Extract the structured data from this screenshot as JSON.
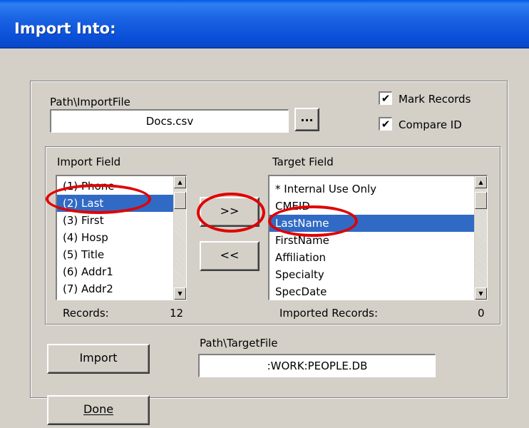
{
  "window": {
    "title": "Import Into:"
  },
  "import_file": {
    "label": "Path\\ImportFile",
    "value": "Docs.csv",
    "browse_label": "..."
  },
  "options": [
    {
      "label": "Mark Records",
      "checked": true
    },
    {
      "label": "Compare ID",
      "checked": true
    }
  ],
  "import_field": {
    "label": "Import Field",
    "items": [
      "(1) Phone",
      "(2) Last",
      "(3) First",
      "(4) Hosp",
      "(5) Title",
      "(6) Addr1",
      "(7) Addr2"
    ],
    "selected": "(2) Last",
    "records_label": "Records:",
    "records_count": "12"
  },
  "move_buttons": {
    "add": ">>",
    "remove": "<<"
  },
  "target_field": {
    "label": "Target Field",
    "items": [
      "* Internal Use Only",
      "CMEID",
      "LastName",
      "FirstName",
      "Affiliation",
      "Specialty",
      "SpecDate"
    ],
    "selected": "LastName",
    "imported_label": "Imported Records:",
    "imported_count": "0"
  },
  "target_file": {
    "label": "Path\\TargetFile",
    "value": ":WORK:PEOPLE.DB"
  },
  "buttons": {
    "import": "Import",
    "done": "Done"
  },
  "annotation_color": "#e00000",
  "selection_color": "#316ac5"
}
